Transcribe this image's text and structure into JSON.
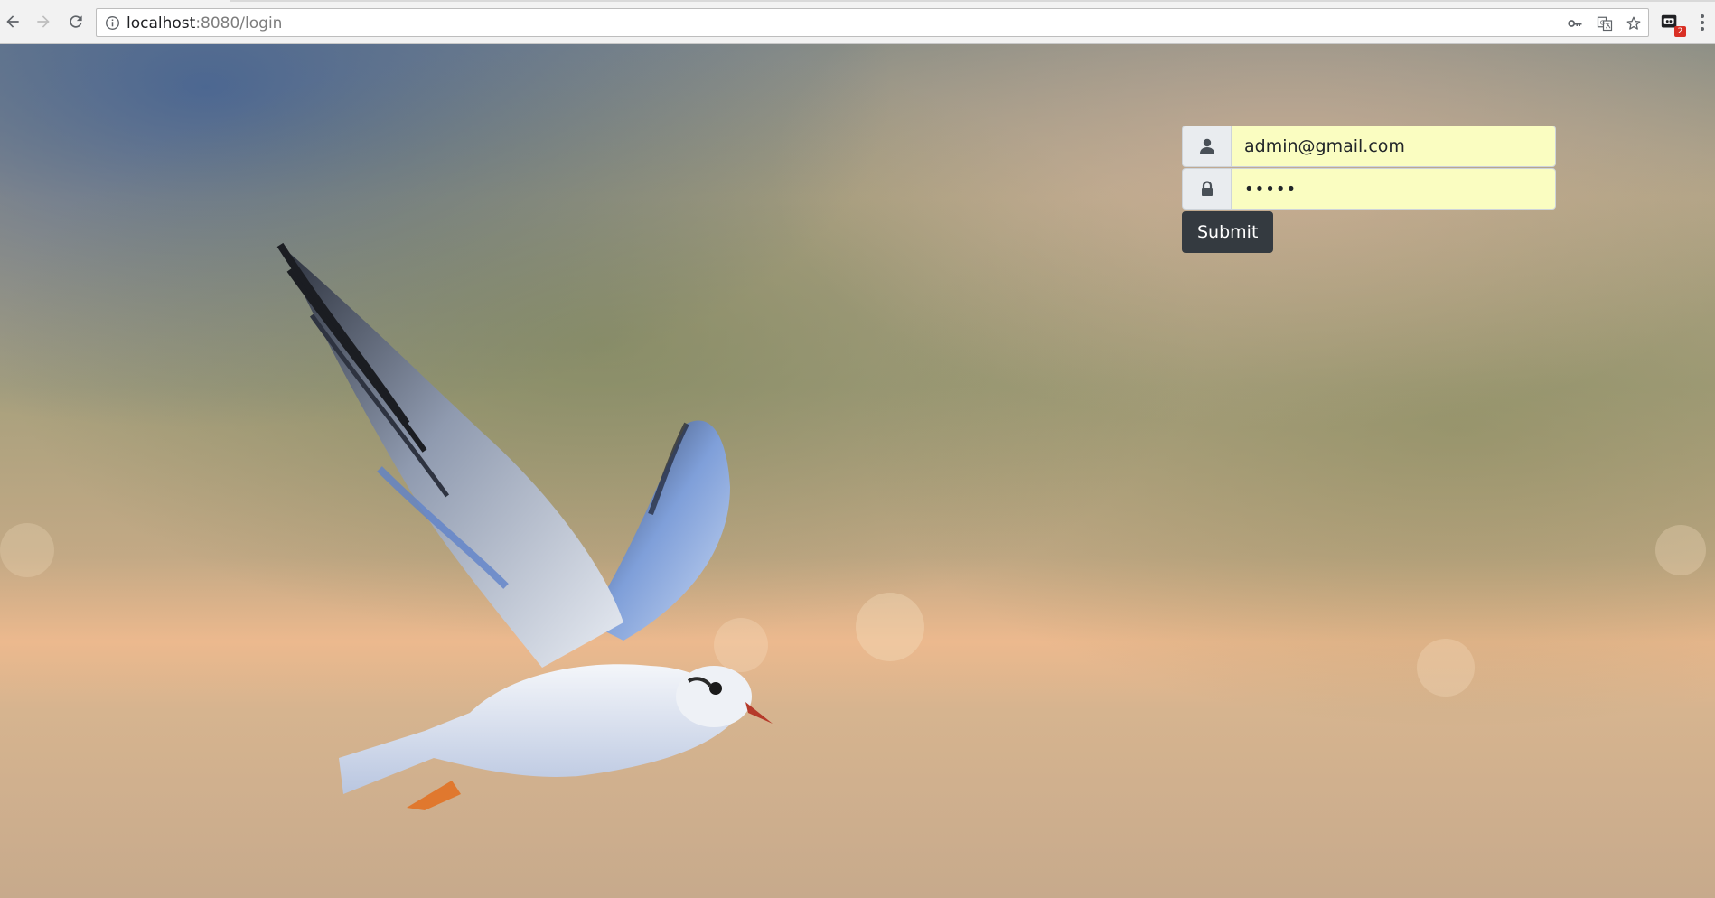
{
  "browser": {
    "url_host": "localhost",
    "url_path": ":8080/login",
    "extension_badge": "2",
    "icons": [
      "back-arrow-icon",
      "forward-arrow-icon",
      "reload-icon",
      "info-icon",
      "key-icon",
      "translate-icon",
      "star-icon",
      "extension-icon",
      "menu-dots-icon"
    ]
  },
  "login": {
    "email_value": "admin@gmail.com",
    "password_value": "•••••",
    "submit_label": "Submit",
    "user_icon": "user-icon",
    "lock_icon": "lock-icon"
  },
  "background": {
    "subject": "flying-seagull-photo"
  },
  "colors": {
    "field_bg": "#fafdc1",
    "addon_bg": "#e9ecef",
    "button_bg": "#343a40"
  }
}
